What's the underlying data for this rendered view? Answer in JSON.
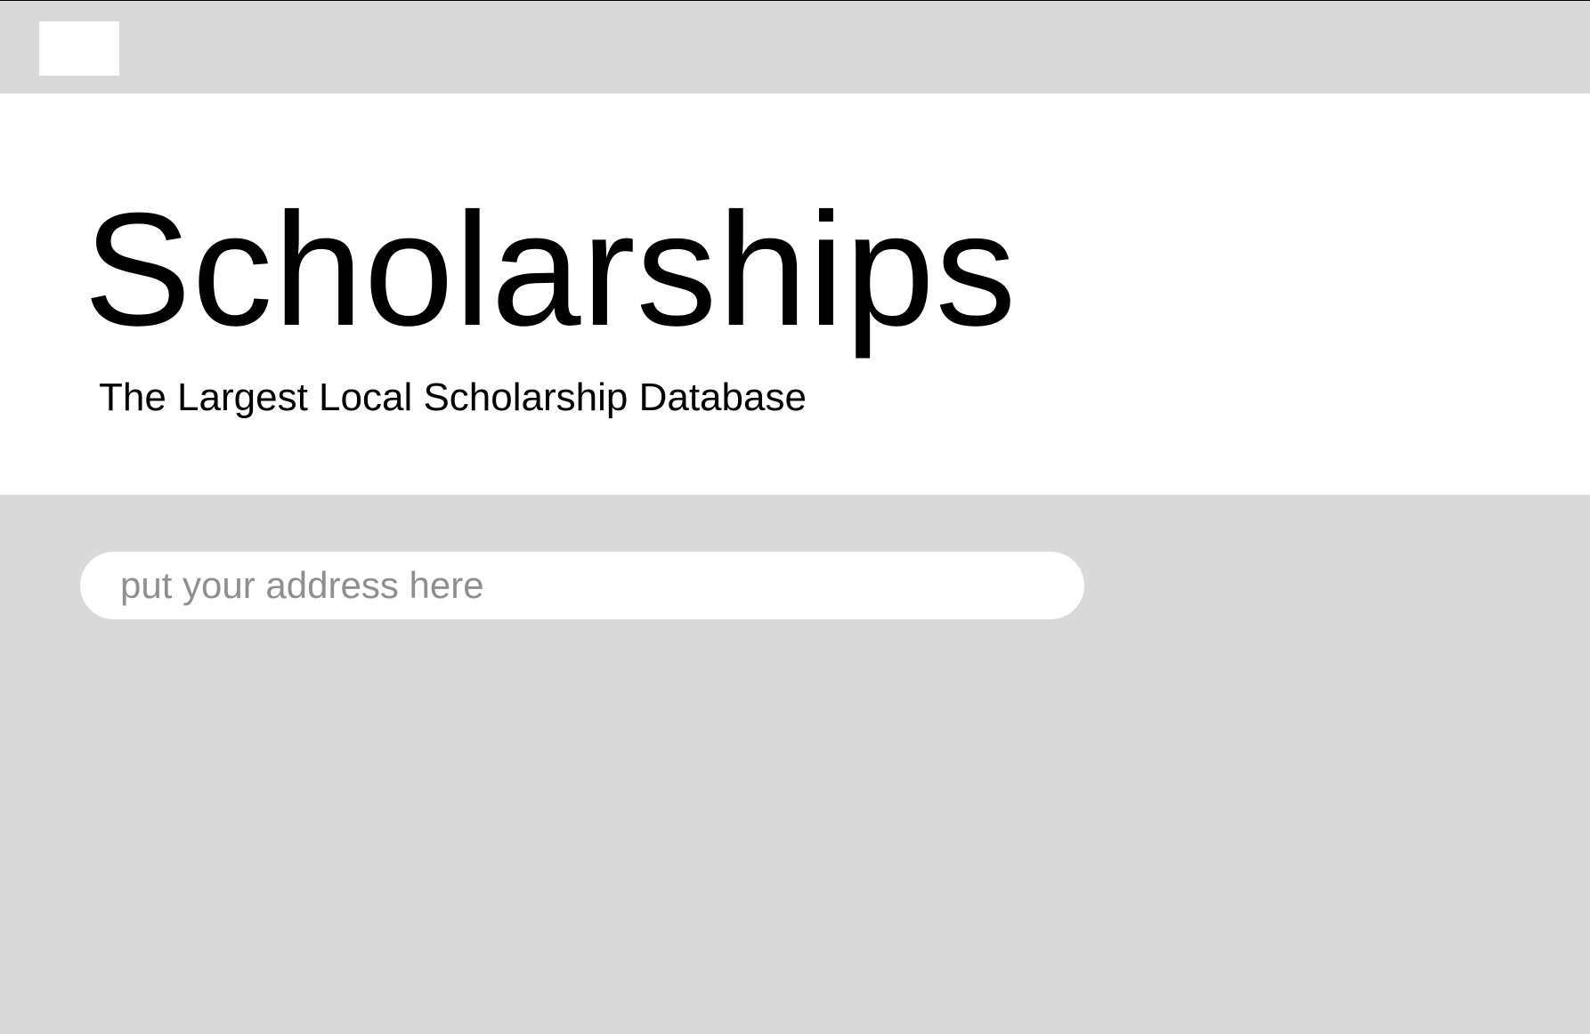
{
  "colors": {
    "background": "#d9d9d9",
    "hero_background": "#ffffff",
    "text": "#000000",
    "placeholder": "#8f8f8f"
  },
  "header": {
    "logo": "logo-placeholder"
  },
  "hero": {
    "title": "Scholarships",
    "subtitle": "The Largest Local Scholarship Database"
  },
  "search": {
    "value": "",
    "placeholder": "put your address here"
  }
}
